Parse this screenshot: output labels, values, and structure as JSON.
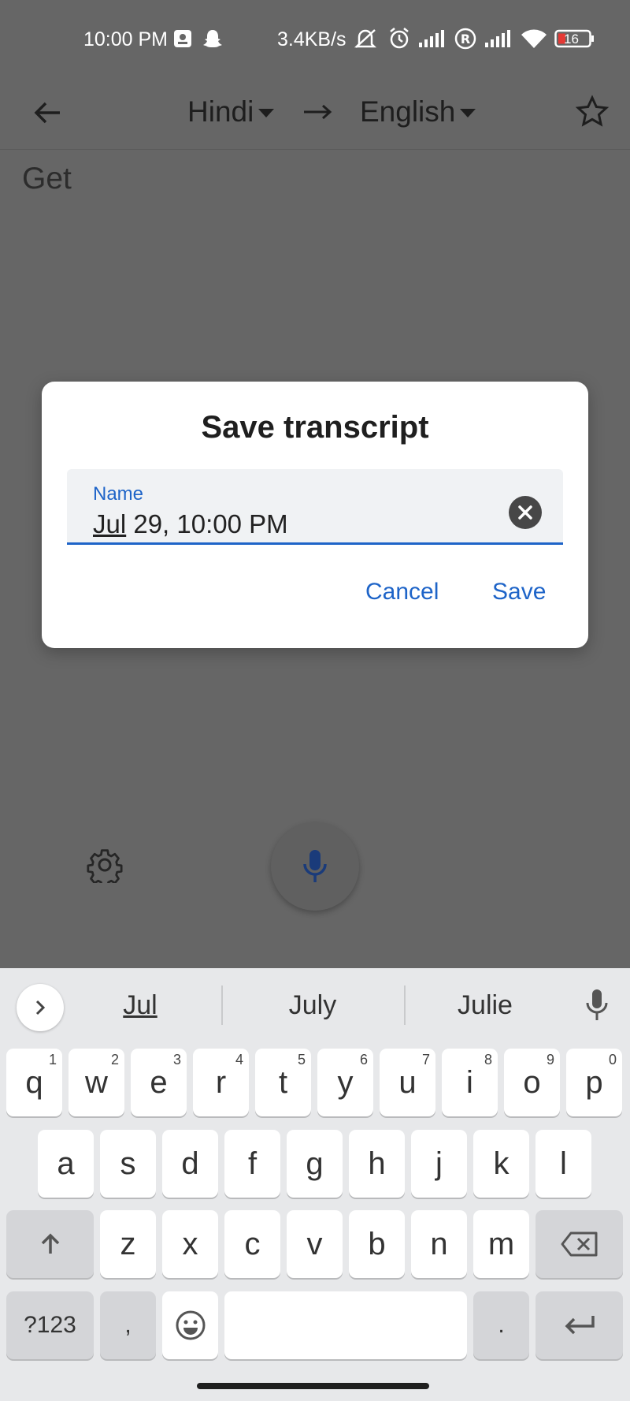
{
  "status_bar": {
    "time": "10:00 PM",
    "speed": "3.4KB/s",
    "battery": "16",
    "icons": [
      "messages-icon",
      "snapchat-icon",
      "mute-icon",
      "alarm-icon",
      "signal-icon",
      "roaming-icon",
      "signal-icon",
      "wifi-icon",
      "battery-icon"
    ]
  },
  "app_bar": {
    "source_lang": "Hindi",
    "target_lang": "English"
  },
  "transcript": {
    "text": "Get"
  },
  "dialog": {
    "title": "Save transcript",
    "field_label": "Name",
    "field_value_underlined": "Jul",
    "field_value_rest": " 29, 10:00 PM",
    "cancel_label": "Cancel",
    "save_label": "Save"
  },
  "keyboard": {
    "suggestions": [
      "Jul",
      "July",
      "Julie"
    ],
    "row1": [
      {
        "k": "q",
        "h": "1"
      },
      {
        "k": "w",
        "h": "2"
      },
      {
        "k": "e",
        "h": "3"
      },
      {
        "k": "r",
        "h": "4"
      },
      {
        "k": "t",
        "h": "5"
      },
      {
        "k": "y",
        "h": "6"
      },
      {
        "k": "u",
        "h": "7"
      },
      {
        "k": "i",
        "h": "8"
      },
      {
        "k": "o",
        "h": "9"
      },
      {
        "k": "p",
        "h": "0"
      }
    ],
    "row2": [
      "a",
      "s",
      "d",
      "f",
      "g",
      "h",
      "j",
      "k",
      "l"
    ],
    "row3": [
      "z",
      "x",
      "c",
      "v",
      "b",
      "n",
      "m"
    ],
    "symbols_label": "?123",
    "comma_label": ",",
    "period_label": "."
  },
  "colors": {
    "accent": "#1e64c8",
    "scrim": "#666666",
    "keyboard_bg": "#e7e8ea"
  }
}
